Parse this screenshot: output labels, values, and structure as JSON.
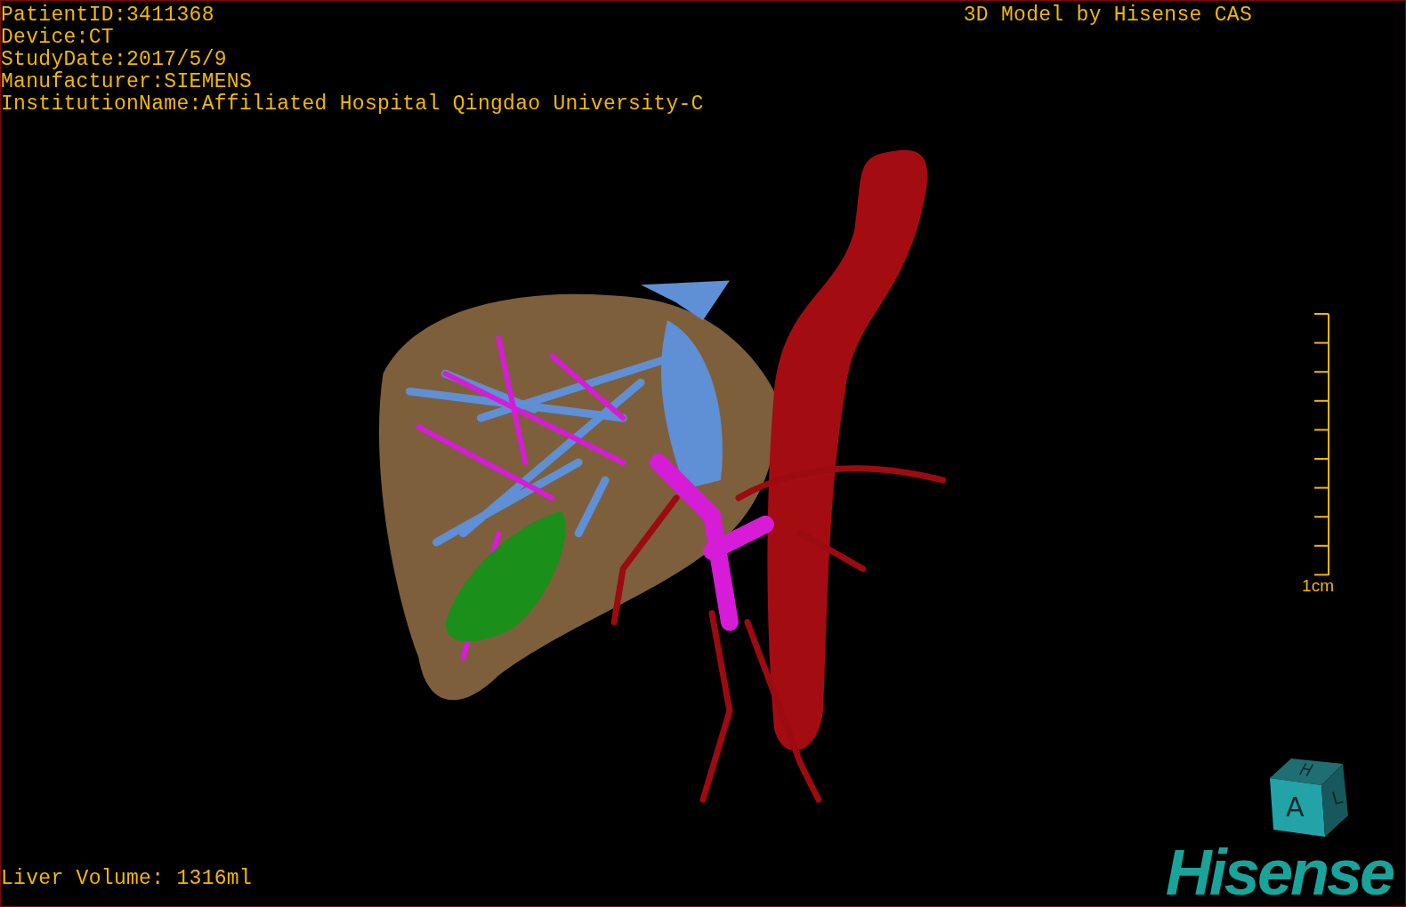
{
  "patient_info": [
    "PatientID:3411368",
    "Device:CT",
    "StudyDate:2017/5/9",
    "Manufacturer:SIEMENS",
    "InstitutionName:Affiliated Hospital Qingdao University-C"
  ],
  "model_credit": "3D Model by Hisense CAS",
  "scale_bar": {
    "label": "1cm"
  },
  "liver_volume": "Liver Volume: 1316ml",
  "orientation_cube": {
    "front": "A",
    "top": "H",
    "side": "L"
  },
  "logo": "Hisense"
}
